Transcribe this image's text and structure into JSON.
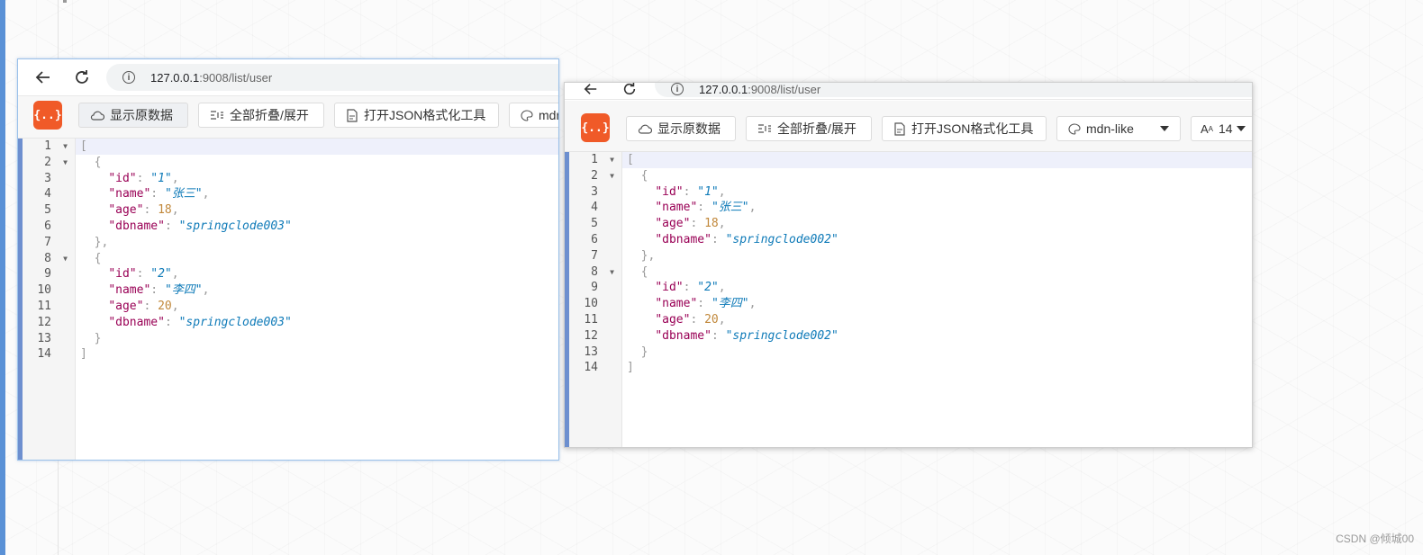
{
  "windows": [
    {
      "url": {
        "host": "127.0.0.1",
        "rest": ":9008/list/user"
      },
      "toolbar": {
        "logo": "{..}",
        "raw_label": "显示原数据",
        "fold_label": "全部折叠/展开",
        "format_label": "打开JSON格式化工具",
        "theme_label": "mdn"
      },
      "code_lines": [
        [
          [
            "p",
            "["
          ]
        ],
        [
          [
            "p",
            "  {"
          ]
        ],
        [
          [
            "p",
            "    "
          ],
          [
            "k",
            "\"id\""
          ],
          [
            "p",
            ": "
          ],
          [
            "s",
            "\"1\""
          ],
          [
            "p",
            ","
          ]
        ],
        [
          [
            "p",
            "    "
          ],
          [
            "k",
            "\"name\""
          ],
          [
            "p",
            ": "
          ],
          [
            "s",
            "\"张三\""
          ],
          [
            "p",
            ","
          ]
        ],
        [
          [
            "p",
            "    "
          ],
          [
            "k",
            "\"age\""
          ],
          [
            "p",
            ": "
          ],
          [
            "n",
            "18"
          ],
          [
            "p",
            ","
          ]
        ],
        [
          [
            "p",
            "    "
          ],
          [
            "k",
            "\"dbname\""
          ],
          [
            "p",
            ": "
          ],
          [
            "s",
            "\"springclode003\""
          ]
        ],
        [
          [
            "p",
            "  },"
          ]
        ],
        [
          [
            "p",
            "  {"
          ]
        ],
        [
          [
            "p",
            "    "
          ],
          [
            "k",
            "\"id\""
          ],
          [
            "p",
            ": "
          ],
          [
            "s",
            "\"2\""
          ],
          [
            "p",
            ","
          ]
        ],
        [
          [
            "p",
            "    "
          ],
          [
            "k",
            "\"name\""
          ],
          [
            "p",
            ": "
          ],
          [
            "s",
            "\"李四\""
          ],
          [
            "p",
            ","
          ]
        ],
        [
          [
            "p",
            "    "
          ],
          [
            "k",
            "\"age\""
          ],
          [
            "p",
            ": "
          ],
          [
            "n",
            "20"
          ],
          [
            "p",
            ","
          ]
        ],
        [
          [
            "p",
            "    "
          ],
          [
            "k",
            "\"dbname\""
          ],
          [
            "p",
            ": "
          ],
          [
            "s",
            "\"springclode003\""
          ]
        ],
        [
          [
            "p",
            "  }"
          ]
        ],
        [
          [
            "p",
            "]"
          ]
        ]
      ],
      "gutter": [
        "1",
        "2",
        "3",
        "4",
        "5",
        "6",
        "7",
        "8",
        "9",
        "10",
        "11",
        "12",
        "13",
        "14"
      ],
      "fold_lines": [
        1,
        2,
        8
      ]
    },
    {
      "url": {
        "host": "127.0.0.1",
        "rest": ":9008/list/user"
      },
      "toolbar": {
        "logo": "{..}",
        "raw_label": "显示原数据",
        "fold_label": "全部折叠/展开",
        "format_label": "打开JSON格式化工具",
        "theme_label": "mdn-like",
        "font_size_label": "14"
      },
      "code_lines": [
        [
          [
            "p",
            "["
          ]
        ],
        [
          [
            "p",
            "  {"
          ]
        ],
        [
          [
            "p",
            "    "
          ],
          [
            "k",
            "\"id\""
          ],
          [
            "p",
            ": "
          ],
          [
            "s",
            "\"1\""
          ],
          [
            "p",
            ","
          ]
        ],
        [
          [
            "p",
            "    "
          ],
          [
            "k",
            "\"name\""
          ],
          [
            "p",
            ": "
          ],
          [
            "s",
            "\"张三\""
          ],
          [
            "p",
            ","
          ]
        ],
        [
          [
            "p",
            "    "
          ],
          [
            "k",
            "\"age\""
          ],
          [
            "p",
            ": "
          ],
          [
            "n",
            "18"
          ],
          [
            "p",
            ","
          ]
        ],
        [
          [
            "p",
            "    "
          ],
          [
            "k",
            "\"dbname\""
          ],
          [
            "p",
            ": "
          ],
          [
            "s",
            "\"springclode002\""
          ]
        ],
        [
          [
            "p",
            "  },"
          ]
        ],
        [
          [
            "p",
            "  {"
          ]
        ],
        [
          [
            "p",
            "    "
          ],
          [
            "k",
            "\"id\""
          ],
          [
            "p",
            ": "
          ],
          [
            "s",
            "\"2\""
          ],
          [
            "p",
            ","
          ]
        ],
        [
          [
            "p",
            "    "
          ],
          [
            "k",
            "\"name\""
          ],
          [
            "p",
            ": "
          ],
          [
            "s",
            "\"李四\""
          ],
          [
            "p",
            ","
          ]
        ],
        [
          [
            "p",
            "    "
          ],
          [
            "k",
            "\"age\""
          ],
          [
            "p",
            ": "
          ],
          [
            "n",
            "20"
          ],
          [
            "p",
            ","
          ]
        ],
        [
          [
            "p",
            "    "
          ],
          [
            "k",
            "\"dbname\""
          ],
          [
            "p",
            ": "
          ],
          [
            "s",
            "\"springclode002\""
          ]
        ],
        [
          [
            "p",
            "  }"
          ]
        ],
        [
          [
            "p",
            "]"
          ]
        ]
      ],
      "gutter": [
        "1",
        "2",
        "3",
        "4",
        "5",
        "6",
        "7",
        "8",
        "9",
        "10",
        "11",
        "12",
        "13",
        "14"
      ],
      "fold_lines": [
        1,
        2,
        8
      ]
    }
  ],
  "watermark": "CSDN @倾城00",
  "colors": {
    "logo": "#f05a28",
    "gutter_accent": "#6d8fcf",
    "key": "#990055",
    "string": "#0e7ab8",
    "number": "#c1883b"
  }
}
